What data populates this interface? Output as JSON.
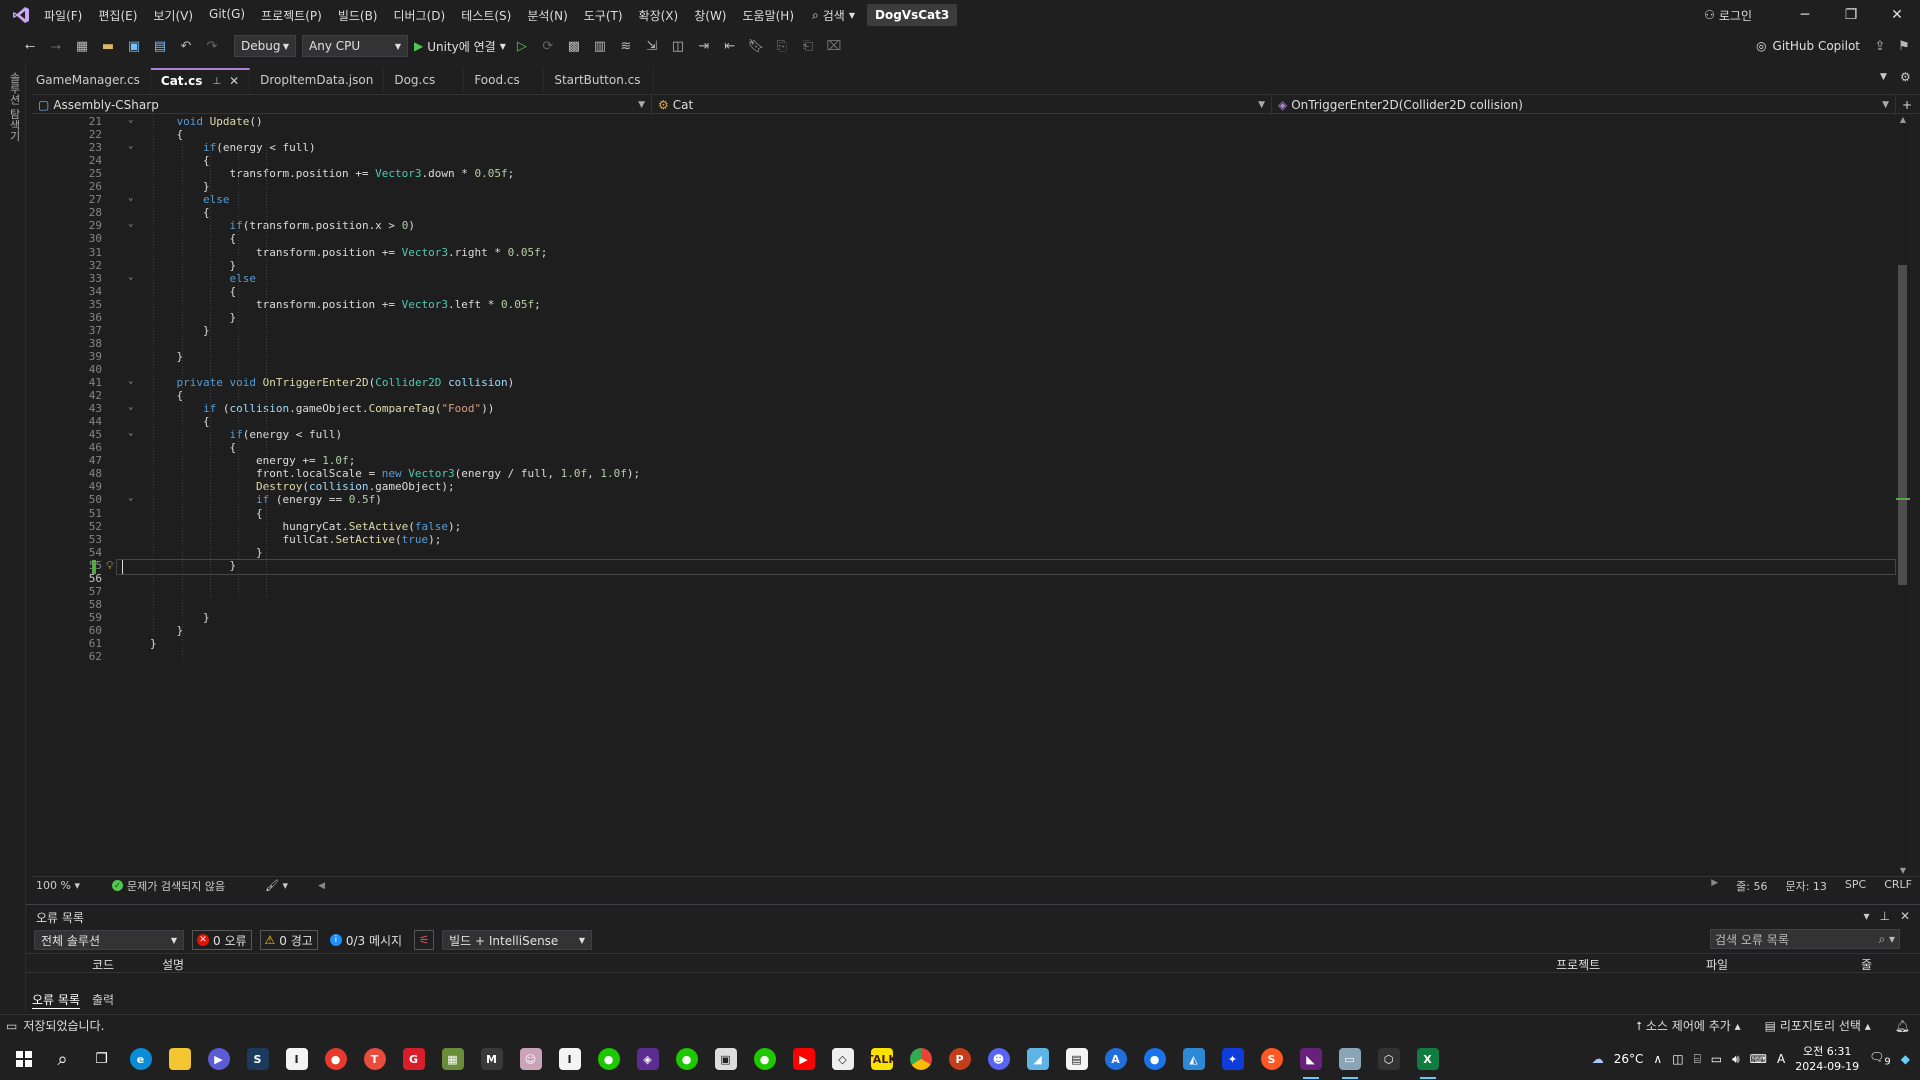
{
  "menu": {
    "items": [
      "파일(F)",
      "편집(E)",
      "보기(V)",
      "Git(G)",
      "프로젝트(P)",
      "빌드(B)",
      "디버그(D)",
      "테스트(S)",
      "분석(N)",
      "도구(T)",
      "확장(X)",
      "창(W)",
      "도움말(H)"
    ],
    "search_label": "검색",
    "project_title": "DogVsCat3",
    "login_label": "로그인"
  },
  "toolbar": {
    "config": "Debug",
    "platform": "Any CPU",
    "run_label": "Unity에 연결",
    "copilot_label": "GitHub Copilot"
  },
  "left_strip": {
    "label": "솔루션 탐색기"
  },
  "tabs": [
    {
      "label": "GameManager.cs",
      "active": false
    },
    {
      "label": "Cat.cs",
      "active": true
    },
    {
      "label": "DropItemData.json",
      "active": false
    },
    {
      "label": "Dog.cs",
      "active": false
    },
    {
      "label": "Food.cs",
      "active": false
    },
    {
      "label": "StartButton.cs",
      "active": false
    }
  ],
  "navbar": {
    "project": "Assembly-CSharp",
    "class": "Cat",
    "member": "OnTriggerEnter2D(Collider2D collision)"
  },
  "code_lines": [
    {
      "n": 21,
      "text": "    void Update()"
    },
    {
      "n": 22,
      "text": "    {"
    },
    {
      "n": 23,
      "text": "        if(energy < full)"
    },
    {
      "n": 24,
      "text": "        {"
    },
    {
      "n": 25,
      "text": "            transform.position += Vector3.down * 0.05f;"
    },
    {
      "n": 26,
      "text": "        }"
    },
    {
      "n": 27,
      "text": "        else"
    },
    {
      "n": 28,
      "text": "        {"
    },
    {
      "n": 29,
      "text": "            if(transform.position.x > 0)"
    },
    {
      "n": 30,
      "text": "            {"
    },
    {
      "n": 31,
      "text": "                transform.position += Vector3.right * 0.05f;"
    },
    {
      "n": 32,
      "text": "            }"
    },
    {
      "n": 33,
      "text": "            else"
    },
    {
      "n": 34,
      "text": "            {"
    },
    {
      "n": 35,
      "text": "                transform.position += Vector3.left * 0.05f;"
    },
    {
      "n": 36,
      "text": "            }"
    },
    {
      "n": 37,
      "text": "        }"
    },
    {
      "n": 38,
      "text": ""
    },
    {
      "n": 39,
      "text": "    }"
    },
    {
      "n": 40,
      "text": ""
    },
    {
      "n": 41,
      "text": "    private void OnTriggerEnter2D(Collider2D collision)"
    },
    {
      "n": 42,
      "text": "    {"
    },
    {
      "n": 43,
      "text": "        if (collision.gameObject.CompareTag(\"Food\"))"
    },
    {
      "n": 44,
      "text": "        {"
    },
    {
      "n": 45,
      "text": "            if(energy < full)"
    },
    {
      "n": 46,
      "text": "            {"
    },
    {
      "n": 47,
      "text": "                energy += 1.0f;"
    },
    {
      "n": 48,
      "text": "                front.localScale = new Vector3(energy / full, 1.0f, 1.0f);"
    },
    {
      "n": 49,
      "text": "                Destroy(collision.gameObject);"
    },
    {
      "n": 50,
      "text": "                if (energy == 0.5f)"
    },
    {
      "n": 51,
      "text": "                {"
    },
    {
      "n": 52,
      "text": "                    hungryCat.SetActive(false);"
    },
    {
      "n": 53,
      "text": "                    fullCat.SetActive(true);"
    },
    {
      "n": 54,
      "text": "                }"
    },
    {
      "n": 55,
      "text": "            }"
    },
    {
      "n": 56,
      "text": ""
    },
    {
      "n": 57,
      "text": ""
    },
    {
      "n": 58,
      "text": ""
    },
    {
      "n": 59,
      "text": "        }"
    },
    {
      "n": 60,
      "text": "    }"
    },
    {
      "n": 61,
      "text": "}"
    },
    {
      "n": 62,
      "text": ""
    }
  ],
  "current_line": 56,
  "editor_status": {
    "zoom": "100 %",
    "issues": "문제가 검색되지 않음",
    "line": "줄: 56",
    "col": "문자: 13",
    "spc": "SPC",
    "eol": "CRLF"
  },
  "error_list": {
    "title": "오류 목록",
    "scope": "전체 솔루션",
    "errors": "0 오류",
    "warnings": "0 경고",
    "messages": "0/3 메시지",
    "build_filter": "빌드 + IntelliSense",
    "search_placeholder": "검색 오류 목록",
    "columns": {
      "code": "코드",
      "desc": "설명",
      "project": "프로젝트",
      "file": "파일",
      "line": "줄"
    },
    "tabs": [
      "오류 목록",
      "출력"
    ]
  },
  "app_status": {
    "message": "저장되었습니다.",
    "source_control": "소스 제어에 추가",
    "repo": "리포지토리 선택"
  },
  "taskbar": {
    "weather": "26°C",
    "time": "오전 6:31",
    "date": "2024-09-19",
    "ime": "A",
    "notifications": "9"
  },
  "colors": {
    "accent": "#b180d7",
    "keyword": "#569cd6",
    "type": "#4ec9b0",
    "string": "#d69d85"
  }
}
